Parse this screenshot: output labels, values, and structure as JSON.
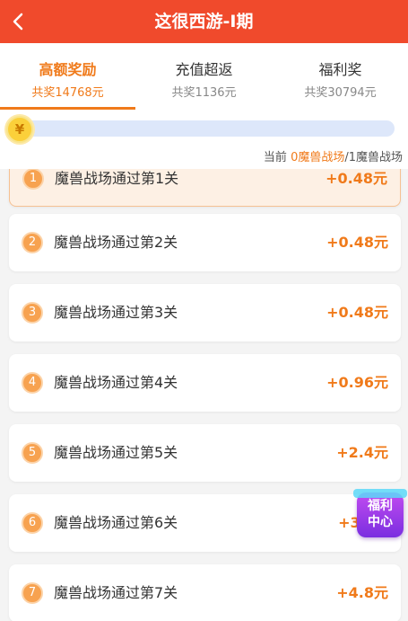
{
  "header": {
    "title": "这很西游-I期",
    "bg_color": "#f04a2c"
  },
  "tabs": [
    {
      "label": "高额奖励",
      "sub": "共奖14768元",
      "active": true
    },
    {
      "label": "充值超返",
      "sub": "共奖1136元",
      "active": false
    },
    {
      "label": "福利奖",
      "sub": "共奖30794元",
      "active": false
    }
  ],
  "progress": {
    "coin_symbol": "¥",
    "fraction": 0,
    "prefix": "当前 ",
    "current": "0魔兽战场",
    "suffix": "/1魔兽战场"
  },
  "tasks": [
    {
      "num": "1",
      "label": "魔兽战场通过第1关",
      "reward": "+0.48元"
    },
    {
      "num": "2",
      "label": "魔兽战场通过第2关",
      "reward": "+0.48元"
    },
    {
      "num": "3",
      "label": "魔兽战场通过第3关",
      "reward": "+0.48元"
    },
    {
      "num": "4",
      "label": "魔兽战场通过第4关",
      "reward": "+0.96元"
    },
    {
      "num": "5",
      "label": "魔兽战场通过第5关",
      "reward": "+2.4元"
    },
    {
      "num": "6",
      "label": "魔兽战场通过第6关",
      "reward": "+3.?元"
    },
    {
      "num": "7",
      "label": "魔兽战场通过第7关",
      "reward": "+4.8元"
    }
  ],
  "welfare": {
    "line1": "福利",
    "line2": "中心"
  },
  "colors": {
    "accent": "#f07a1a",
    "welfare": "#9b3ae8"
  }
}
